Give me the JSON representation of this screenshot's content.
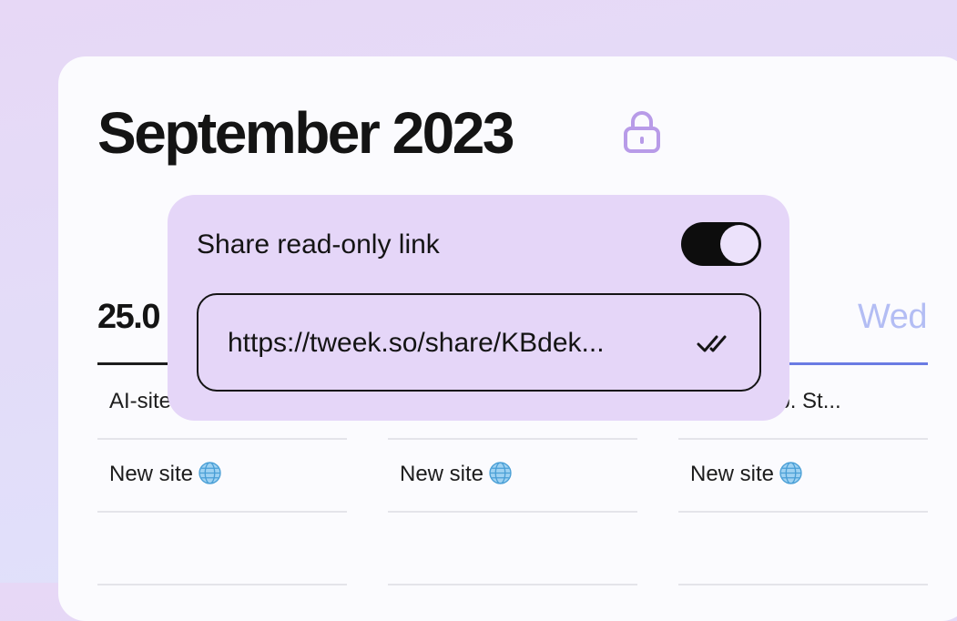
{
  "header": {
    "title": "September 2023"
  },
  "columns": [
    {
      "date": "25.0",
      "cells": [
        "AI-site",
        "New site"
      ]
    },
    {
      "cells": [
        "",
        "New site"
      ]
    },
    {
      "day": "Wed",
      "cells": [
        "ap. St...",
        "New site"
      ]
    }
  ],
  "share_popover": {
    "label": "Share read-only link",
    "toggle_on": true,
    "link": "https://tweek.so/share/KBdek..."
  },
  "icons": [
    "lock-icon",
    "globe-icon",
    "double-check-icon"
  ],
  "colors": {
    "accent_purple": "#b89be8",
    "popover_bg": "#e5d6f8",
    "active_underline": "#6a7be3"
  }
}
